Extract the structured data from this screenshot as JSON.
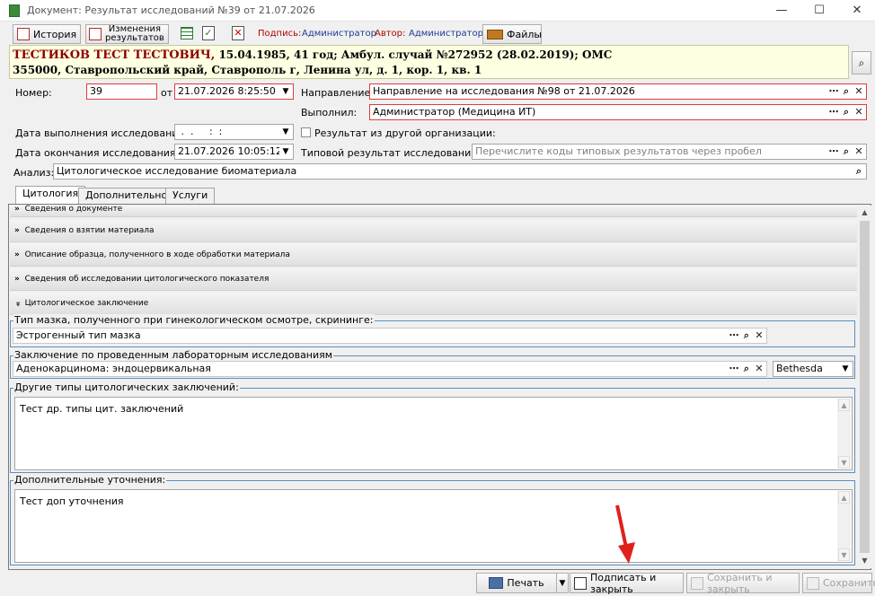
{
  "window": {
    "title": "Документ: Результат исследований №39 от 21.07.2026",
    "minimize": "—",
    "maximize": "☐",
    "close": "✕"
  },
  "toolbar": {
    "history": "История",
    "changes_line1": "Изменения",
    "changes_line2": "результатов",
    "signature_label": "Подпись:",
    "signature_value": "Администратор",
    "author_label": "Автор:",
    "author_value": "Администратор",
    "files": "Файлы"
  },
  "patient": {
    "name": "ТЕСТИКОВ ТЕСТ ТЕСТОВИЧ,",
    "details": " 15.04.1985, 41 год; Амбул. случай №272952 (28.02.2019); ОМС",
    "address": "355000, Ставропольский край, Ставрополь г, Ленина ул, д. 1, кор. 1, кв. 1"
  },
  "form": {
    "number_label": "Номер:",
    "number_value": "39",
    "from_label": "от",
    "date_value": "21.07.2026 8:25:50",
    "direction_label": "Направление:",
    "direction_value": "Направление на исследования №98 от 21.07.2026",
    "performed_label": "Выполнил:",
    "performed_value": "Администратор (Медицина ИТ)",
    "exec_date_label": "Дата выполнения исследования:",
    "exec_date_value": " .  .     :  :",
    "other_org_label": "Результат из другой организации:",
    "end_date_label": "Дата окончания исследования:",
    "end_date_value": "21.07.2026 10:05:12",
    "typical_label": "Типовой результат исследования:",
    "typical_placeholder": "Перечислите коды типовых результатов через пробел",
    "analysis_label": "Анализ:",
    "analysis_value": "Цитологическое исследование биоматериала"
  },
  "tabs": [
    "Цитология",
    "Дополнительно",
    "Услуги"
  ],
  "sections": [
    {
      "icon": "»",
      "label": "Сведения о документе"
    },
    {
      "icon": "»",
      "label": "Сведения о взятии материала"
    },
    {
      "icon": "»",
      "label": "Описание образца, полученного в ходе обработки материала"
    },
    {
      "icon": "»",
      "label": "Сведения об исследовании цитологического показателя"
    },
    {
      "icon": "¥",
      "label": "Цитологическое заключение"
    }
  ],
  "groups": {
    "smear_label": "Тип мазка, полученного при гинекологическом осмотре, скрининге:",
    "smear_value": "Эстрогенный тип мазка",
    "conclusion_label": "Заключение по проведенным лабораторным исследованиям",
    "conclusion_value": "Аденокарцинома: эндоцервикальная",
    "conclusion_system": "Bethesda",
    "other_label": "Другие типы цитологических заключений:",
    "other_value": "Тест др. типы цит. заключений",
    "extra_label": "Дополнительные уточнения:",
    "extra_value": "Тест доп уточнения"
  },
  "footer": {
    "print": "Печать",
    "sign_close": "Подписать и закрыть",
    "save_close": "Сохранить и закрыть",
    "save": "Сохранить"
  },
  "colors": {
    "arrow": "#e0201b",
    "required_border": "#e03b3b",
    "group_border": "#5a8fc0",
    "patient_bg": "#ffffe1"
  }
}
